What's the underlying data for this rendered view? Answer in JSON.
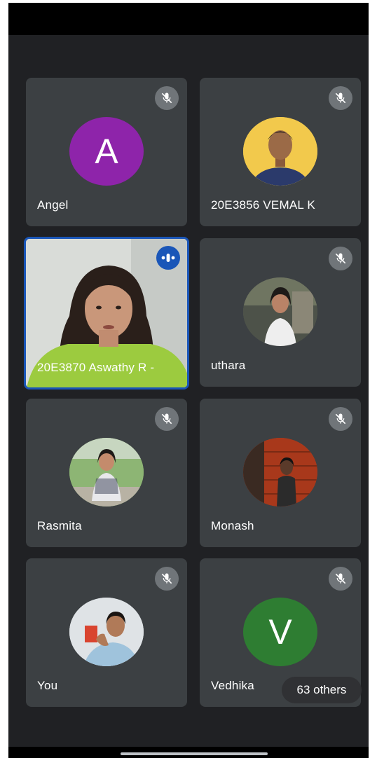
{
  "participants": [
    {
      "name": "Angel",
      "avatar": "letter",
      "letter": "A",
      "avatar_color": "#8e24aa",
      "muted": true
    },
    {
      "name": "20E3856 VEMAL K",
      "avatar": "photo",
      "avatar_color": "#f2c94c",
      "muted": true
    },
    {
      "name": "20E3870 Aswathy R -",
      "avatar": "video",
      "speaking": true
    },
    {
      "name": "uthara",
      "avatar": "photo",
      "avatar_color": "#5a5f55",
      "muted": true
    },
    {
      "name": "Rasmita",
      "avatar": "photo",
      "avatar_color": "#7fa36a",
      "muted": true
    },
    {
      "name": "Monash",
      "avatar": "photo",
      "avatar_color": "#b5401f",
      "muted": true
    },
    {
      "name": "You",
      "avatar": "photo",
      "avatar_color": "#cfd4d8",
      "muted": true
    },
    {
      "name": "Vedhika",
      "avatar": "letter",
      "letter": "V",
      "avatar_color": "#2e7d32",
      "muted": true
    }
  ],
  "others_label": "63 others",
  "icons": {
    "muted": "mic-off-icon",
    "speaking": "audio-level-icon"
  },
  "colors": {
    "background": "#202124",
    "tile": "#3c4043",
    "active_border": "#1a56b8"
  }
}
